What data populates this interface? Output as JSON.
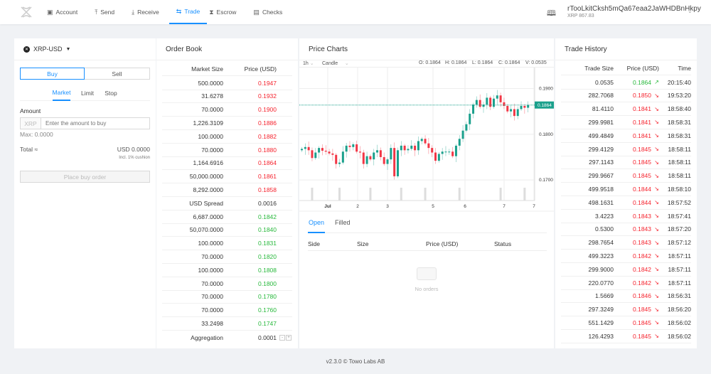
{
  "nav": {
    "items": [
      {
        "label": "Account",
        "icon": "account-icon",
        "g": "▣"
      },
      {
        "label": "Send",
        "icon": "send-icon",
        "g": "⤒"
      },
      {
        "label": "Receive",
        "icon": "receive-icon",
        "g": "⤓"
      },
      {
        "label": "Trade",
        "icon": "swap-icon",
        "g": "⇆",
        "active": true
      },
      {
        "label": "Escrow",
        "icon": "hourglass-icon",
        "g": "⧗"
      },
      {
        "label": "Checks",
        "icon": "check-icon",
        "g": "▤"
      }
    ],
    "address": "rTooLkitCksh5mQa67eaa2JaWHDBnHkpy",
    "balance": "XRP 867.83"
  },
  "trade": {
    "pair": "XRP-USD",
    "buy": "Buy",
    "sell": "Sell",
    "tabs": [
      "Market",
      "Limit",
      "Stop"
    ],
    "amount_label": "Amount",
    "currency": "XRP",
    "placeholder": "Enter the amount to buy",
    "max": "Max: 0.0000",
    "total_label": "Total ≈",
    "total": "USD 0.0000",
    "cushion": "Incl. 1% cushion",
    "place": "Place buy order"
  },
  "orderbook": {
    "title": "Order Book",
    "col_size": "Market Size",
    "col_price": "Price (USD)",
    "asks": [
      [
        "500.0000",
        "0.1947"
      ],
      [
        "31.6278",
        "0.1932"
      ],
      [
        "70.0000",
        "0.1900"
      ],
      [
        "1,226.3109",
        "0.1886"
      ],
      [
        "100.0000",
        "0.1882"
      ],
      [
        "70.0000",
        "0.1880"
      ],
      [
        "1,164.6916",
        "0.1864"
      ],
      [
        "50,000.0000",
        "0.1861"
      ],
      [
        "8,292.0000",
        "0.1858"
      ]
    ],
    "spread_label": "USD Spread",
    "spread": "0.0016",
    "bids": [
      [
        "6,687.0000",
        "0.1842"
      ],
      [
        "50,070.0000",
        "0.1840"
      ],
      [
        "100.0000",
        "0.1831"
      ],
      [
        "70.0000",
        "0.1820"
      ],
      [
        "100.0000",
        "0.1808"
      ],
      [
        "70.0000",
        "0.1800"
      ],
      [
        "70.0000",
        "0.1780"
      ],
      [
        "70.0000",
        "0.1760"
      ],
      [
        "33.2498",
        "0.1747"
      ]
    ],
    "aggregation_label": "Aggregation",
    "aggregation": "0.0001",
    "minus": "-",
    "plus": "+"
  },
  "chart": {
    "title": "Price Charts",
    "interval": "1h",
    "type": "Candle",
    "o": "O: 0.1864",
    "h": "H: 0.1864",
    "l": "L: 0.1864",
    "c": "C: 0.1864",
    "v": "V: 0.0535",
    "last": "0.1864"
  },
  "chart_data": {
    "type": "candlestick",
    "ylim": [
      0.1655,
      0.1946
    ],
    "yticks": [
      "0.1900",
      "0.1800",
      "0.1700"
    ],
    "xticks": [
      "Jul",
      "2",
      "3",
      "5",
      "6",
      "7",
      "7"
    ],
    "up_color": "#1aa08c",
    "down_color": "#f23645",
    "closes": [
      0.1768,
      0.1772,
      0.1765,
      0.1748,
      0.176,
      0.177,
      0.1764,
      0.1762,
      0.1758,
      0.1755,
      0.1735,
      0.1738,
      0.1762,
      0.1775,
      0.1772,
      0.1778,
      0.1762,
      0.176,
      0.1735,
      0.1752,
      0.1745,
      0.176,
      0.1765,
      0.175,
      0.1735,
      0.1745,
      0.177,
      0.1708,
      0.1765,
      0.1775,
      0.1765,
      0.1768,
      0.1775,
      0.1765,
      0.1785,
      0.179,
      0.178,
      0.177,
      0.176,
      0.1742,
      0.1757,
      0.1762,
      0.1762,
      0.1762,
      0.1752,
      0.1775,
      0.179,
      0.1808,
      0.1822,
      0.1845,
      0.1865,
      0.1875,
      0.186,
      0.1865,
      0.188,
      0.186,
      0.1878,
      0.1885,
      0.187,
      0.1862,
      0.185,
      0.1855,
      0.184,
      0.1855,
      0.1862,
      0.1858,
      0.1864
    ],
    "volumes_marked": [
      3,
      11,
      20,
      29,
      36,
      46,
      58,
      65
    ]
  },
  "orders": {
    "tabs": [
      "Open",
      "Filled"
    ],
    "cols": [
      "Side",
      "Size",
      "Price (USD)",
      "Status"
    ],
    "empty": "No orders"
  },
  "history": {
    "title": "Trade History",
    "cols": [
      "Trade Size",
      "Price (USD)",
      "Time"
    ],
    "rows": [
      [
        "0.0535",
        "0.1864",
        "20:15:40",
        "up"
      ],
      [
        "282.7068",
        "0.1850",
        "19:53:20",
        "down"
      ],
      [
        "81.4110",
        "0.1841",
        "18:58:40",
        "down"
      ],
      [
        "299.9981",
        "0.1841",
        "18:58:31",
        "down"
      ],
      [
        "499.4849",
        "0.1841",
        "18:58:31",
        "down"
      ],
      [
        "299.4129",
        "0.1845",
        "18:58:11",
        "down"
      ],
      [
        "297.1143",
        "0.1845",
        "18:58:11",
        "down"
      ],
      [
        "299.9667",
        "0.1845",
        "18:58:11",
        "down"
      ],
      [
        "499.9518",
        "0.1844",
        "18:58:10",
        "down"
      ],
      [
        "498.1631",
        "0.1844",
        "18:57:52",
        "down"
      ],
      [
        "3.4223",
        "0.1843",
        "18:57:41",
        "down"
      ],
      [
        "0.5300",
        "0.1843",
        "18:57:20",
        "down"
      ],
      [
        "298.7654",
        "0.1843",
        "18:57:12",
        "down"
      ],
      [
        "499.3223",
        "0.1842",
        "18:57:11",
        "down"
      ],
      [
        "299.9000",
        "0.1842",
        "18:57:11",
        "down"
      ],
      [
        "220.0770",
        "0.1842",
        "18:57:11",
        "down"
      ],
      [
        "1.5669",
        "0.1846",
        "18:56:31",
        "down"
      ],
      [
        "297.3249",
        "0.1845",
        "18:56:20",
        "down"
      ],
      [
        "551.1429",
        "0.1845",
        "18:56:02",
        "down"
      ],
      [
        "126.4293",
        "0.1845",
        "18:56:02",
        "down"
      ]
    ]
  },
  "footer": "v2.3.0 © Towo Labs AB"
}
